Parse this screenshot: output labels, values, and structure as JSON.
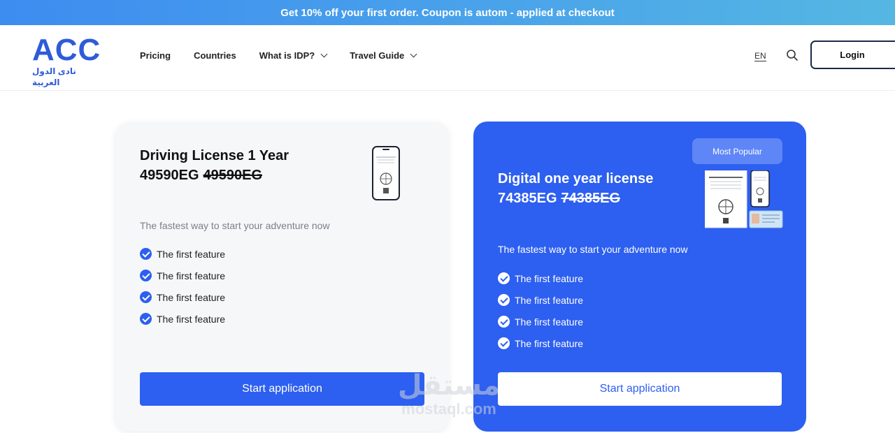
{
  "promo": {
    "text": "Get 10% off your first order. Coupon is autom - applied at checkout"
  },
  "brand": {
    "mark": "ACC",
    "subtitle": "نادى الدول العربية",
    "color": "#2e5bd8"
  },
  "nav": {
    "items": [
      {
        "label": "Pricing",
        "dropdown": false
      },
      {
        "label": "Countries",
        "dropdown": false
      },
      {
        "label": "What is IDP?",
        "dropdown": true
      },
      {
        "label": "Travel Guide",
        "dropdown": true
      }
    ],
    "lang": "EN",
    "search_icon": "search-icon",
    "login_label": "Login"
  },
  "plans": [
    {
      "title": "Driving License 1 Year",
      "price": "49590EG",
      "old_price": "49590EG",
      "tagline": "The fastest way to start your adventure now",
      "features": [
        "The first feature",
        "The first feature",
        "The first feature",
        "The first feature"
      ],
      "cta": "Start application"
    },
    {
      "badge": "Most Popular",
      "title": "Digital one year license",
      "price": "74385EG",
      "old_price": "74385EG",
      "tagline": "The fastest way to start your adventure now",
      "features": [
        "The first feature",
        "The first feature",
        "The first feature",
        "The first feature"
      ],
      "cta": "Start application"
    }
  ],
  "watermark": {
    "arabic": "مستقل",
    "latin": "mostaql.com"
  },
  "colors": {
    "primary": "#2d5ff0",
    "promo_start": "#3d8cf0",
    "promo_end": "#55b7e2",
    "card_bg": "#f6f7f9"
  }
}
